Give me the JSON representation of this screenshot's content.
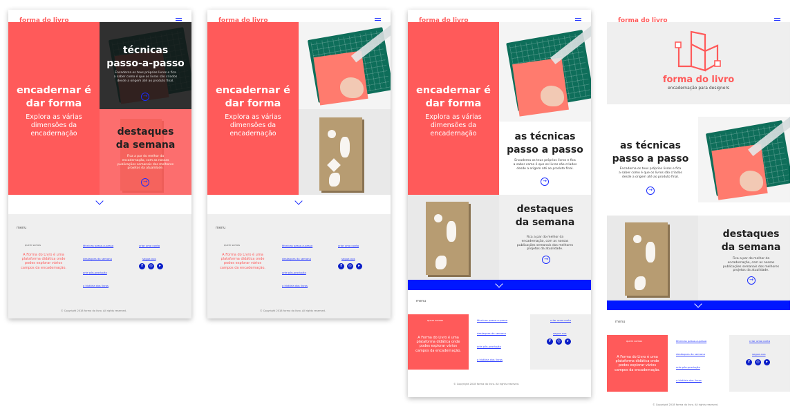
{
  "brand": {
    "logo": "forma do livro",
    "tagline": "encadernação para designers",
    "coral": "#ff5a5a",
    "blue": "#0017ff"
  },
  "icons": {
    "menu": "hamburger-icon",
    "arrow": "arrow-right-circle-icon",
    "chevron": "chevron-down-icon"
  },
  "hero": {
    "title_l1": "encadernar é",
    "title_l2": "dar forma",
    "sub_l1": "Explora as várias",
    "sub_l2": "dimensões da",
    "sub_l3": "encadernação"
  },
  "tecnicas": {
    "title_hyph_l1": "técnicas",
    "title_hyph_l2": "passo-a-passo",
    "title_l1": "as técnicas",
    "title_l2": "passo a passo",
    "text_l1": "Encaderna os teus próprios livros e fica",
    "text_l2": "a saber como é que os livros são criados",
    "text_l3": "desde a origem até ao produto final."
  },
  "destaques": {
    "title_l1": "destaques",
    "title_l2": "da semana",
    "text_l1": "Fica a par do melhor da",
    "text_l2": "encadernação, com as nossas",
    "text_l3": "publicações semanais dos melhores",
    "text_l4": "projetos da atualidade."
  },
  "footer": {
    "menu": "menu",
    "quem_somos": "quem somos",
    "about_l1": "A Forma do Livro é uma",
    "about_l2": "plataforma didática onde",
    "about_l3": "podes explorar vários",
    "about_l4": "campos da encadernação.",
    "link1": "técnicas passo-a-passo",
    "link2": "destaques da semana",
    "link3": "arte pós-produção",
    "link4": "a história dos livros",
    "contact": "criar uma conta",
    "follow": "segue-nos",
    "copyright": "Copyright 2018 forma do livro. All rights reserved."
  }
}
